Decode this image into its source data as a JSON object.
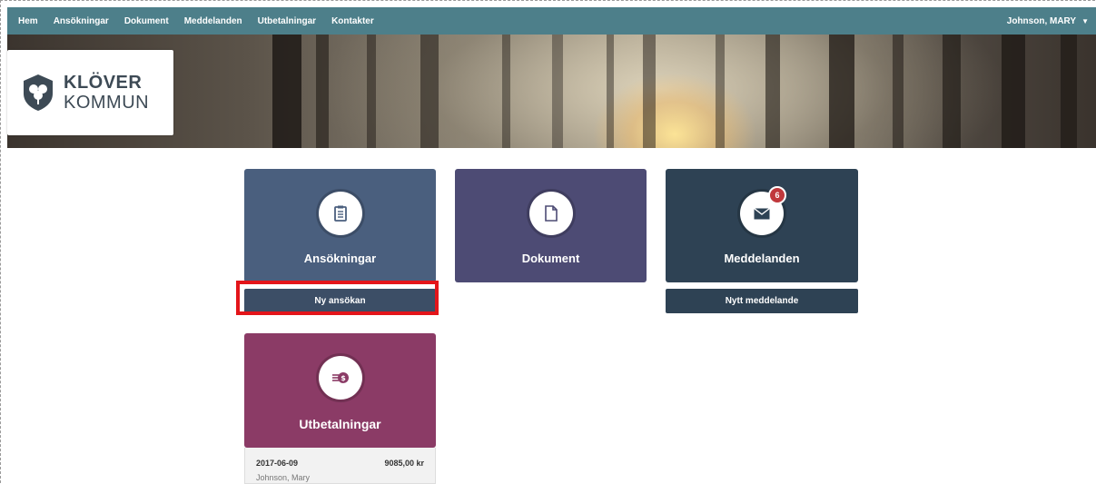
{
  "nav": {
    "items": [
      {
        "label": "Hem"
      },
      {
        "label": "Ansökningar"
      },
      {
        "label": "Dokument"
      },
      {
        "label": "Meddelanden"
      },
      {
        "label": "Utbetalningar"
      },
      {
        "label": "Kontakter"
      }
    ],
    "user": "Johnson, MARY",
    "user_icon": "caret-down-icon"
  },
  "logo": {
    "line1": "KLÖVER",
    "line2": "KOMMUN",
    "icon": "clover-shield-icon",
    "color": "#3d4a55"
  },
  "tiles": {
    "ansokningar": {
      "label": "Ansökningar",
      "icon": "clipboard-icon",
      "color": "#4a5f7e"
    },
    "dokument": {
      "label": "Dokument",
      "icon": "document-icon",
      "color": "#4d4b74"
    },
    "meddelanden": {
      "label": "Meddelanden",
      "icon": "envelope-icon",
      "color": "#2e4254",
      "badge": "6"
    },
    "utbetalningar": {
      "label": "Utbetalningar",
      "icon": "money-icon",
      "color": "#8b3b66"
    }
  },
  "actions": {
    "ny_ansokan": "Ny ansökan",
    "nytt_meddelande": "Nytt meddelande"
  },
  "payments": [
    {
      "date": "2017-06-09",
      "amount": "9085,00 kr",
      "name": "Johnson, Mary"
    }
  ],
  "highlight_color": "#e3151a"
}
